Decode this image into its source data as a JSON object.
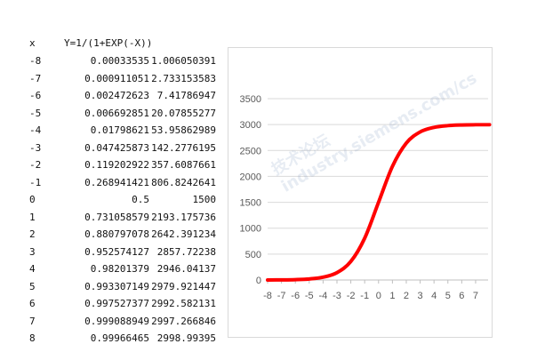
{
  "sheet": {
    "headers": {
      "x": "x",
      "y": "Y=1/(1+EXP(-X))"
    },
    "rows": [
      {
        "x": "-8",
        "y": "0.00033535",
        "z": "1.006050391"
      },
      {
        "x": "-7",
        "y": "0.000911051",
        "z": "2.733153583"
      },
      {
        "x": "-6",
        "y": "0.002472623",
        "z": "7.41786947"
      },
      {
        "x": "-5",
        "y": "0.006692851",
        "z": "20.07855277"
      },
      {
        "x": "-4",
        "y": "0.01798621",
        "z": "53.95862989"
      },
      {
        "x": "-3",
        "y": "0.047425873",
        "z": "142.2776195"
      },
      {
        "x": "-2",
        "y": "0.119202922",
        "z": "357.6087661"
      },
      {
        "x": "-1",
        "y": "0.268941421",
        "z": "806.8242641"
      },
      {
        "x": "0",
        "y": "0.5",
        "z": "1500"
      },
      {
        "x": "1",
        "y": "0.731058579",
        "z": "2193.175736"
      },
      {
        "x": "2",
        "y": "0.880797078",
        "z": "2642.391234"
      },
      {
        "x": "3",
        "y": "0.952574127",
        "z": "2857.72238"
      },
      {
        "x": "4",
        "y": "0.98201379",
        "z": "2946.04137"
      },
      {
        "x": "5",
        "y": "0.993307149",
        "z": "2979.921447"
      },
      {
        "x": "6",
        "y": "0.997527377",
        "z": "2992.582131"
      },
      {
        "x": "7",
        "y": "0.999088949",
        "z": "2997.266846"
      },
      {
        "x": "8",
        "y": "0.99966465",
        "z": "2998.99395"
      }
    ]
  },
  "watermark": {
    "text": "技术论坛 industry.siemens.com/cs"
  },
  "chart_data": {
    "type": "line",
    "x": [
      -8,
      -7,
      -6,
      -5,
      -4,
      -3,
      -2,
      -1,
      0,
      1,
      2,
      3,
      4,
      5,
      6,
      7,
      8
    ],
    "series": [
      {
        "values": [
          1.006,
          2.733,
          7.418,
          20.079,
          53.959,
          142.278,
          357.609,
          806.824,
          1500,
          2193.176,
          2642.391,
          2857.722,
          2946.041,
          2979.921,
          2992.582,
          2997.267,
          2998.994
        ],
        "color": "#ff0000"
      }
    ],
    "x_ticks": [
      -8,
      -7,
      -6,
      -5,
      -4,
      -3,
      -2,
      -1,
      0,
      1,
      2,
      3,
      4,
      5,
      6,
      7
    ],
    "y_ticks": [
      0,
      500,
      1000,
      1500,
      2000,
      2500,
      3000,
      3500
    ],
    "ylim": [
      0,
      3500
    ],
    "grid": true,
    "gridColor": "#d9d9d9",
    "title": "",
    "xlabel": "",
    "ylabel": ""
  }
}
